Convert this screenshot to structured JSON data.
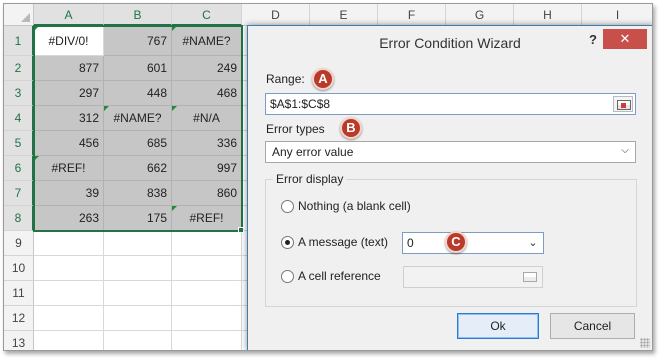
{
  "sheet": {
    "columns": [
      "A",
      "B",
      "C",
      "D",
      "E",
      "F",
      "G",
      "H",
      "I"
    ],
    "rows": [
      "1",
      "2",
      "3",
      "4",
      "5",
      "6",
      "7",
      "8",
      "9",
      "10",
      "11",
      "12",
      "13"
    ],
    "cells": [
      [
        "#DIV/0!",
        "767",
        "#NAME?"
      ],
      [
        "877",
        "601",
        "249"
      ],
      [
        "297",
        "448",
        "468"
      ],
      [
        "312",
        "#NAME?",
        "#N/A"
      ],
      [
        "456",
        "685",
        "336"
      ],
      [
        "#REF!",
        "662",
        "997"
      ],
      [
        "39",
        "838",
        "860"
      ],
      [
        "263",
        "175",
        "#REF!"
      ]
    ],
    "selection_color": "#217346",
    "shade_color": "#c6c6c6"
  },
  "dialog": {
    "title": "Error Condition Wizard",
    "help_label": "?",
    "close_label": "✕",
    "range_label": "Range:",
    "range_value": "$A$1:$C$8",
    "error_types_label": "Error types",
    "error_types_value": "Any error value",
    "error_display_label": "Error display",
    "options": {
      "nothing": "Nothing (a blank cell)",
      "message": "A message (text)",
      "cell_reference": "A cell reference"
    },
    "selected_option": "message",
    "message_value": "0",
    "ok_label": "Ok",
    "cancel_label": "Cancel",
    "badges": [
      "A",
      "B",
      "C"
    ],
    "accent_color": "#b83a2a",
    "close_color": "#c7504a"
  }
}
